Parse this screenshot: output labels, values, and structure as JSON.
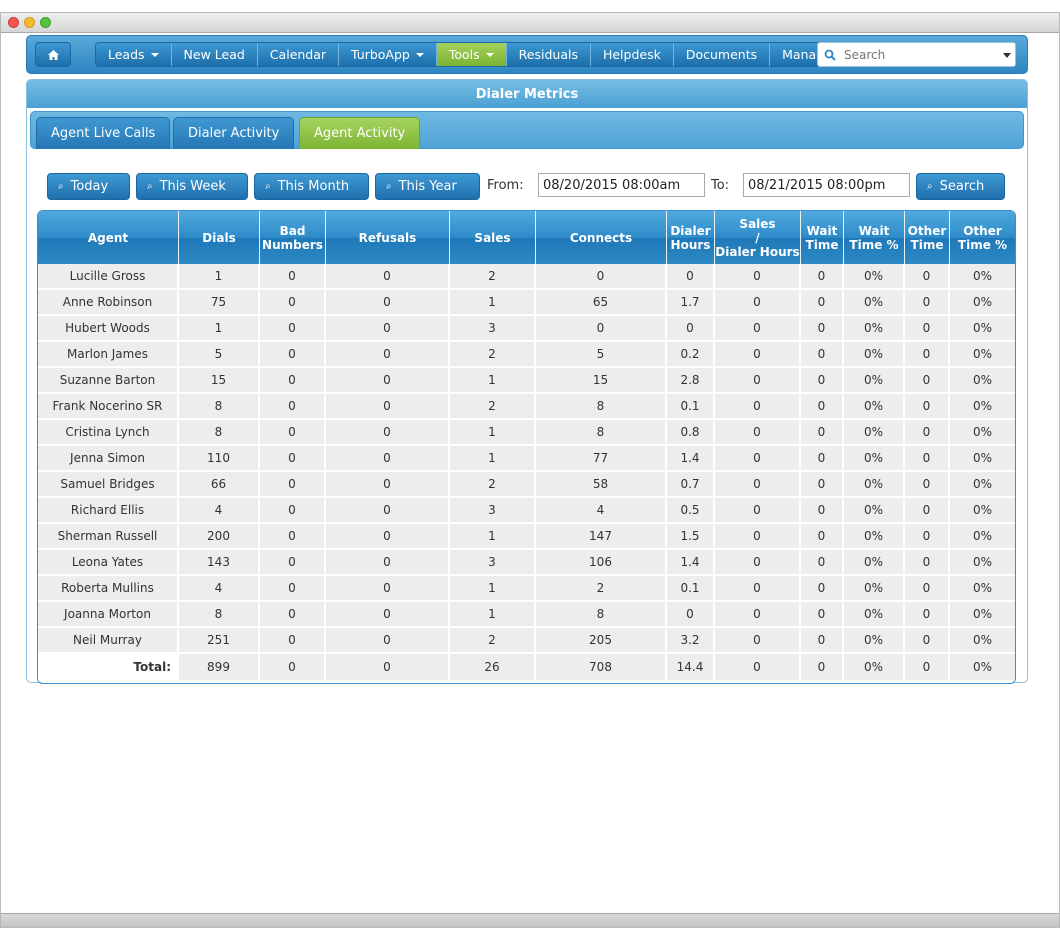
{
  "nav": {
    "home_icon": "home-icon",
    "items": [
      {
        "label": "Leads",
        "dropdown": true
      },
      {
        "label": "New Lead",
        "dropdown": false
      },
      {
        "label": "Calendar",
        "dropdown": false
      },
      {
        "label": "TurboApp",
        "dropdown": true
      },
      {
        "label": "Tools",
        "dropdown": true,
        "active": true
      },
      {
        "label": "Residuals",
        "dropdown": false
      },
      {
        "label": "Helpdesk",
        "dropdown": false
      },
      {
        "label": "Documents",
        "dropdown": false
      },
      {
        "label": "Manage",
        "dropdown": true
      }
    ],
    "search_placeholder": "Search"
  },
  "panel": {
    "title": "Dialer Metrics",
    "tabs": [
      "Agent Live Calls",
      "Dialer Activity",
      "Agent Activity"
    ],
    "active_tab": "Agent Activity"
  },
  "filters": {
    "today": "Today",
    "this_week": "This Week",
    "this_month": "This Month",
    "this_year": "This Year",
    "from_label": "From:",
    "from_value": "08/20/2015 08:00am",
    "to_label": "To:",
    "to_value": "08/21/2015 08:00pm",
    "search": "Search"
  },
  "table": {
    "columns": [
      "Agent",
      "Dials",
      "Bad Numbers",
      "Refusals",
      "Sales",
      "Connects",
      "Dialer Hours",
      "Sales / Dialer Hours",
      "Wait Time",
      "Wait Time %",
      "Other Time",
      "Other Time %"
    ],
    "rows": [
      [
        "Lucille Gross",
        "1",
        "0",
        "0",
        "2",
        "0",
        "0",
        "0",
        "0",
        "0%",
        "0",
        "0%"
      ],
      [
        "Anne Robinson",
        "75",
        "0",
        "0",
        "1",
        "65",
        "1.7",
        "0",
        "0",
        "0%",
        "0",
        "0%"
      ],
      [
        "Hubert Woods",
        "1",
        "0",
        "0",
        "3",
        "0",
        "0",
        "0",
        "0",
        "0%",
        "0",
        "0%"
      ],
      [
        "Marlon James",
        "5",
        "0",
        "0",
        "2",
        "5",
        "0.2",
        "0",
        "0",
        "0%",
        "0",
        "0%"
      ],
      [
        "Suzanne Barton",
        "15",
        "0",
        "0",
        "1",
        "15",
        "2.8",
        "0",
        "0",
        "0%",
        "0",
        "0%"
      ],
      [
        "Frank Nocerino SR",
        "8",
        "0",
        "0",
        "2",
        "8",
        "0.1",
        "0",
        "0",
        "0%",
        "0",
        "0%"
      ],
      [
        "Cristina Lynch",
        "8",
        "0",
        "0",
        "1",
        "8",
        "0.8",
        "0",
        "0",
        "0%",
        "0",
        "0%"
      ],
      [
        "Jenna Simon",
        "110",
        "0",
        "0",
        "1",
        "77",
        "1.4",
        "0",
        "0",
        "0%",
        "0",
        "0%"
      ],
      [
        "Samuel Bridges",
        "66",
        "0",
        "0",
        "2",
        "58",
        "0.7",
        "0",
        "0",
        "0%",
        "0",
        "0%"
      ],
      [
        "Richard Ellis",
        "4",
        "0",
        "0",
        "3",
        "4",
        "0.5",
        "0",
        "0",
        "0%",
        "0",
        "0%"
      ],
      [
        "Sherman Russell",
        "200",
        "0",
        "0",
        "1",
        "147",
        "1.5",
        "0",
        "0",
        "0%",
        "0",
        "0%"
      ],
      [
        "Leona Yates",
        "143",
        "0",
        "0",
        "3",
        "106",
        "1.4",
        "0",
        "0",
        "0%",
        "0",
        "0%"
      ],
      [
        "Roberta Mullins",
        "4",
        "0",
        "0",
        "1",
        "2",
        "0.1",
        "0",
        "0",
        "0%",
        "0",
        "0%"
      ],
      [
        "Joanna Morton",
        "8",
        "0",
        "0",
        "1",
        "8",
        "0",
        "0",
        "0",
        "0%",
        "0",
        "0%"
      ],
      [
        "Neil Murray",
        "251",
        "0",
        "0",
        "2",
        "205",
        "3.2",
        "0",
        "0",
        "0%",
        "0",
        "0%"
      ]
    ],
    "total": [
      "Total:",
      "899",
      "0",
      "0",
      "26",
      "708",
      "14.4",
      "0",
      "0",
      "0%",
      "0",
      "0%"
    ]
  },
  "colors": {
    "nav_blue": "#2f86c2",
    "active_green": "#8bc34a",
    "header_blue": "#2f8cc9",
    "row_gray": "#ededed"
  }
}
